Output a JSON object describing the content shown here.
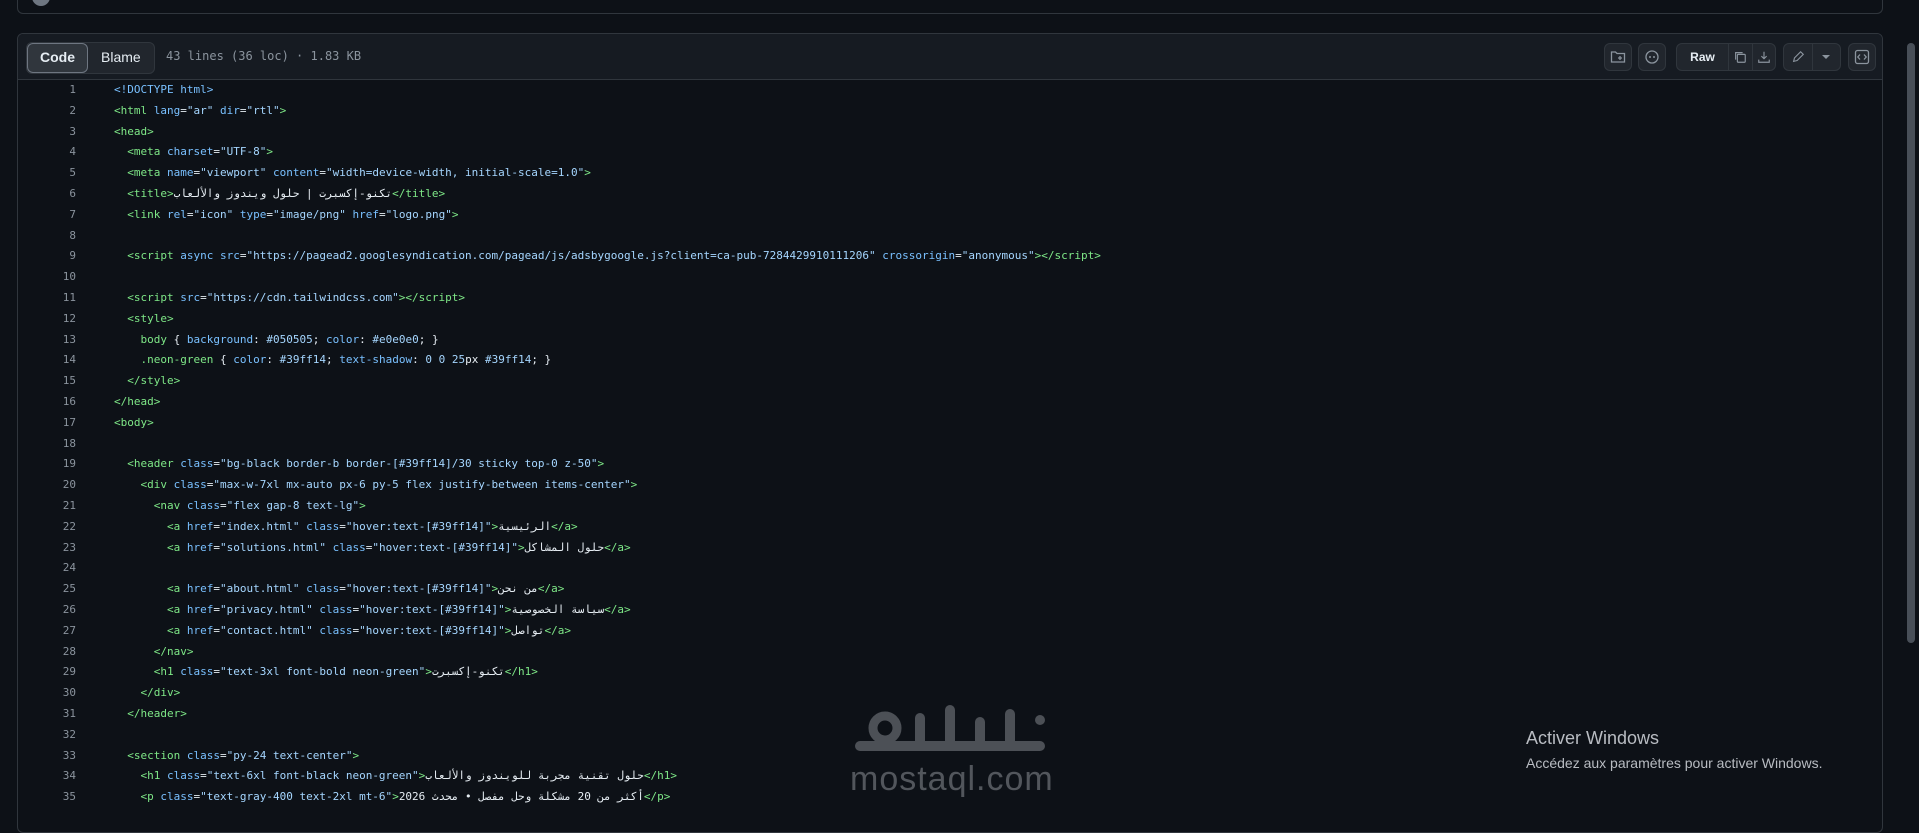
{
  "toolbar": {
    "tabs": [
      "Code",
      "Blame"
    ],
    "active_tab": "Code",
    "file_meta": "43 lines (36 loc) · 1.83 KB",
    "raw_label": "Raw"
  },
  "code": {
    "lines": [
      {
        "n": "1",
        "html": "<span class=\"a\">&lt;!DOCTYPE html&gt;</span>"
      },
      {
        "n": "2",
        "html": "<span class=\"t\">&lt;html</span> <span class=\"a\">lang</span>=<span class=\"s\">\"ar\"</span> <span class=\"a\">dir</span>=<span class=\"s\">\"rtl\"</span><span class=\"t\">&gt;</span>"
      },
      {
        "n": "3",
        "html": "<span class=\"t\">&lt;head&gt;</span>"
      },
      {
        "n": "4",
        "html": "  <span class=\"t\">&lt;meta</span> <span class=\"a\">charset</span>=<span class=\"s\">\"UTF-8\"</span><span class=\"t\">&gt;</span>"
      },
      {
        "n": "5",
        "html": "  <span class=\"t\">&lt;meta</span> <span class=\"a\">name</span>=<span class=\"s\">\"viewport\"</span> <span class=\"a\">content</span>=<span class=\"s\">\"width=device-width, initial-scale=1.0\"</span><span class=\"t\">&gt;</span>"
      },
      {
        "n": "6",
        "html": "  <span class=\"t\">&lt;title&gt;</span>تكنو-إكسبرت | حلول ويندوز والألعاب<span class=\"t\">&lt;/title&gt;</span>"
      },
      {
        "n": "7",
        "html": "  <span class=\"t\">&lt;link</span> <span class=\"a\">rel</span>=<span class=\"s\">\"icon\"</span> <span class=\"a\">type</span>=<span class=\"s\">\"image/png\"</span> <span class=\"a\">href</span>=<span class=\"s\">\"logo.png\"</span><span class=\"t\">&gt;</span>"
      },
      {
        "n": "8",
        "html": ""
      },
      {
        "n": "9",
        "html": "  <span class=\"t\">&lt;script</span> <span class=\"a\">async</span> <span class=\"a\">src</span>=<span class=\"s\">\"https://pagead2.googlesyndication.com/pagead/js/adsbygoogle.js?client=ca-pub-7284429910111206\"</span> <span class=\"a\">crossorigin</span>=<span class=\"s\">\"anonymous\"</span><span class=\"t\">&gt;&lt;/script&gt;</span>"
      },
      {
        "n": "10",
        "html": ""
      },
      {
        "n": "11",
        "html": "  <span class=\"t\">&lt;script</span> <span class=\"a\">src</span>=<span class=\"s\">\"https://cdn.tailwindcss.com\"</span><span class=\"t\">&gt;&lt;/script&gt;</span>"
      },
      {
        "n": "12",
        "html": "  <span class=\"t\">&lt;style&gt;</span>"
      },
      {
        "n": "13",
        "html": "    <span class=\"t\">body</span> { <span class=\"a\">background</span>: <span class=\"s\">#050505</span>; <span class=\"a\">color</span>: <span class=\"s\">#e0e0e0</span>; }"
      },
      {
        "n": "14",
        "html": "    <span class=\"t\">.neon-green</span> { <span class=\"a\">color</span>: <span class=\"s\">#39ff14</span>; <span class=\"a\">text-shadow</span>: <span class=\"s\">0 0 25</span>px <span class=\"s\">#39ff14</span>; }"
      },
      {
        "n": "15",
        "html": "  <span class=\"t\">&lt;/style&gt;</span>"
      },
      {
        "n": "16",
        "html": "<span class=\"t\">&lt;/head&gt;</span>"
      },
      {
        "n": "17",
        "html": "<span class=\"t\">&lt;body&gt;</span>"
      },
      {
        "n": "18",
        "html": ""
      },
      {
        "n": "19",
        "html": "  <span class=\"t\">&lt;header</span> <span class=\"a\">class</span>=<span class=\"s\">\"bg-black border-b border-[#39ff14]/30 sticky top-0 z-50\"</span><span class=\"t\">&gt;</span>"
      },
      {
        "n": "20",
        "html": "    <span class=\"t\">&lt;div</span> <span class=\"a\">class</span>=<span class=\"s\">\"max-w-7xl mx-auto px-6 py-5 flex justify-between items-center\"</span><span class=\"t\">&gt;</span>"
      },
      {
        "n": "21",
        "html": "      <span class=\"t\">&lt;nav</span> <span class=\"a\">class</span>=<span class=\"s\">\"flex gap-8 text-lg\"</span><span class=\"t\">&gt;</span>"
      },
      {
        "n": "22",
        "html": "        <span class=\"t\">&lt;a</span> <span class=\"a\">href</span>=<span class=\"s\">\"index.html\"</span> <span class=\"a\">class</span>=<span class=\"s\">\"hover:text-[#39ff14]\"</span><span class=\"t\">&gt;</span>الرئيسية<span class=\"t\">&lt;/a&gt;</span>"
      },
      {
        "n": "23",
        "html": "        <span class=\"t\">&lt;a</span> <span class=\"a\">href</span>=<span class=\"s\">\"solutions.html\"</span> <span class=\"a\">class</span>=<span class=\"s\">\"hover:text-[#39ff14]\"</span><span class=\"t\">&gt;</span>حلول المشاكل<span class=\"t\">&lt;/a&gt;</span>"
      },
      {
        "n": "24",
        "html": ""
      },
      {
        "n": "25",
        "html": "        <span class=\"t\">&lt;a</span> <span class=\"a\">href</span>=<span class=\"s\">\"about.html\"</span> <span class=\"a\">class</span>=<span class=\"s\">\"hover:text-[#39ff14]\"</span><span class=\"t\">&gt;</span>من نحن<span class=\"t\">&lt;/a&gt;</span>"
      },
      {
        "n": "26",
        "html": "        <span class=\"t\">&lt;a</span> <span class=\"a\">href</span>=<span class=\"s\">\"privacy.html\"</span> <span class=\"a\">class</span>=<span class=\"s\">\"hover:text-[#39ff14]\"</span><span class=\"t\">&gt;</span>سياسة الخصوصية<span class=\"t\">&lt;/a&gt;</span>"
      },
      {
        "n": "27",
        "html": "        <span class=\"t\">&lt;a</span> <span class=\"a\">href</span>=<span class=\"s\">\"contact.html\"</span> <span class=\"a\">class</span>=<span class=\"s\">\"hover:text-[#39ff14]\"</span><span class=\"t\">&gt;</span>تواصل<span class=\"t\">&lt;/a&gt;</span>"
      },
      {
        "n": "28",
        "html": "      <span class=\"t\">&lt;/nav&gt;</span>"
      },
      {
        "n": "29",
        "html": "      <span class=\"t\">&lt;h1</span> <span class=\"a\">class</span>=<span class=\"s\">\"text-3xl font-bold neon-green\"</span><span class=\"t\">&gt;</span>تكنو-إكسبرت<span class=\"t\">&lt;/h1&gt;</span>"
      },
      {
        "n": "30",
        "html": "    <span class=\"t\">&lt;/div&gt;</span>"
      },
      {
        "n": "31",
        "html": "  <span class=\"t\">&lt;/header&gt;</span>"
      },
      {
        "n": "32",
        "html": ""
      },
      {
        "n": "33",
        "html": "  <span class=\"t\">&lt;section</span> <span class=\"a\">class</span>=<span class=\"s\">\"py-24 text-center\"</span><span class=\"t\">&gt;</span>"
      },
      {
        "n": "34",
        "html": "    <span class=\"t\">&lt;h1</span> <span class=\"a\">class</span>=<span class=\"s\">\"text-6xl font-black neon-green\"</span><span class=\"t\">&gt;</span>حلول تقنية مجربة للويندوز والألعاب<span class=\"t\">&lt;/h1&gt;</span>"
      },
      {
        "n": "35",
        "html": "    <span class=\"t\">&lt;p</span> <span class=\"a\">class</span>=<span class=\"s\">\"text-gray-400 text-2xl mt-6\"</span><span class=\"t\">&gt;</span>أكثر من 20 مشكلة وحل مفصل • محدث 2026<span class=\"t\">&lt;/p&gt;</span>"
      }
    ]
  },
  "watermark": {
    "text": "mostaql.com",
    "logo_text": "مستقل"
  },
  "activation": {
    "title": "Activer Windows",
    "subtitle": "Accédez aux paramètres pour activer Windows."
  }
}
